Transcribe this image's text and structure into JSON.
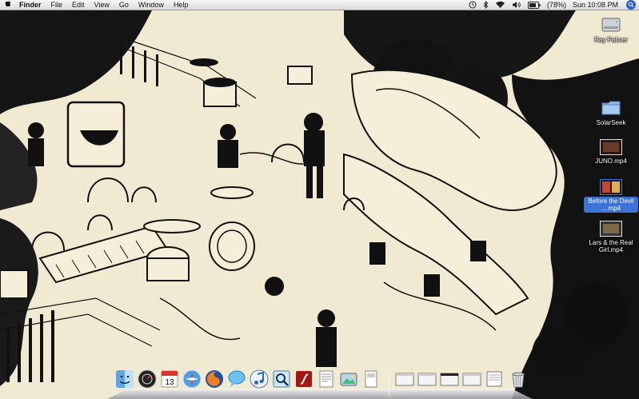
{
  "menubar": {
    "apple_glyph": "",
    "app_name": "Finder",
    "menus": [
      "File",
      "Edit",
      "View",
      "Go",
      "Window",
      "Help"
    ],
    "status": {
      "time_machine": "time-machine-icon",
      "bluetooth": "bluetooth-icon",
      "wifi": "wifi-icon",
      "volume": "volume-icon",
      "battery_percent": "(78%)",
      "clock": "Sun 10:08 PM",
      "spotlight": "spotlight-icon"
    }
  },
  "desktop": {
    "icons": [
      {
        "label": "Ray Palmer",
        "kind": "hard-drive"
      },
      {
        "label": "SolarSeek",
        "kind": "folder"
      },
      {
        "label": "JUNO.mp4",
        "kind": "movie"
      },
      {
        "label": "Before the Devil ....mp4",
        "kind": "movie",
        "selected": true
      },
      {
        "label": "Lars & the Real Girl.mp4",
        "kind": "movie"
      }
    ]
  },
  "dock": {
    "calendar_day": "13",
    "items": [
      "finder",
      "dashboard",
      "ical",
      "safari",
      "firefox",
      "ichat",
      "itunes",
      "preview",
      "flash",
      "textedit",
      "iphoto",
      "documents",
      "window-1",
      "window-2",
      "window-3",
      "window-4",
      "window-5",
      "trash"
    ]
  },
  "colors": {
    "wallpaper_paper": "#f1ead2",
    "ink": "#111111",
    "selection": "#3b73d6"
  }
}
